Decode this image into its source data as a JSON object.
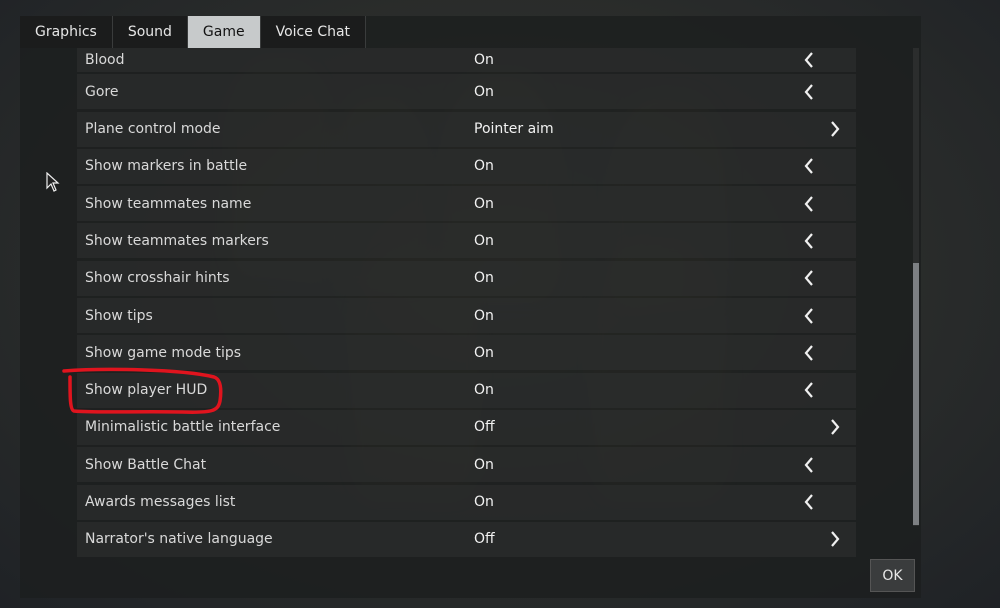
{
  "tabs": [
    {
      "label": "Graphics",
      "active": false
    },
    {
      "label": "Sound",
      "active": false
    },
    {
      "label": "Game",
      "active": true
    },
    {
      "label": "Voice Chat",
      "active": false
    }
  ],
  "settings": [
    {
      "label": "Blood",
      "value": "On",
      "arrow": "left"
    },
    {
      "label": "Gore",
      "value": "On",
      "arrow": "left"
    },
    {
      "label": "Plane control mode",
      "value": "Pointer aim",
      "arrow": "right"
    },
    {
      "label": "Show markers in battle",
      "value": "On",
      "arrow": "left"
    },
    {
      "label": "Show teammates name",
      "value": "On",
      "arrow": "left"
    },
    {
      "label": "Show teammates markers",
      "value": "On",
      "arrow": "left"
    },
    {
      "label": "Show crosshair hints",
      "value": "On",
      "arrow": "left"
    },
    {
      "label": "Show tips",
      "value": "On",
      "arrow": "left"
    },
    {
      "label": "Show game mode tips",
      "value": "On",
      "arrow": "left"
    },
    {
      "label": "Show player HUD",
      "value": "On",
      "arrow": "left"
    },
    {
      "label": "Minimalistic battle interface",
      "value": "Off",
      "arrow": "right"
    },
    {
      "label": "Show Battle Chat",
      "value": "On",
      "arrow": "left"
    },
    {
      "label": "Awards messages list",
      "value": "On",
      "arrow": "left"
    },
    {
      "label": "Narrator's native language",
      "value": "Off",
      "arrow": "right"
    }
  ],
  "ok_label": "OK",
  "colors": {
    "active_tab_bg": "#c7cacb",
    "annotation": "#e0141e",
    "scroll_thumb": "#7d8083"
  },
  "icons": {
    "left_arrow": "chevron-left-icon",
    "right_arrow": "chevron-right-icon",
    "cursor": "mouse-pointer-icon"
  }
}
